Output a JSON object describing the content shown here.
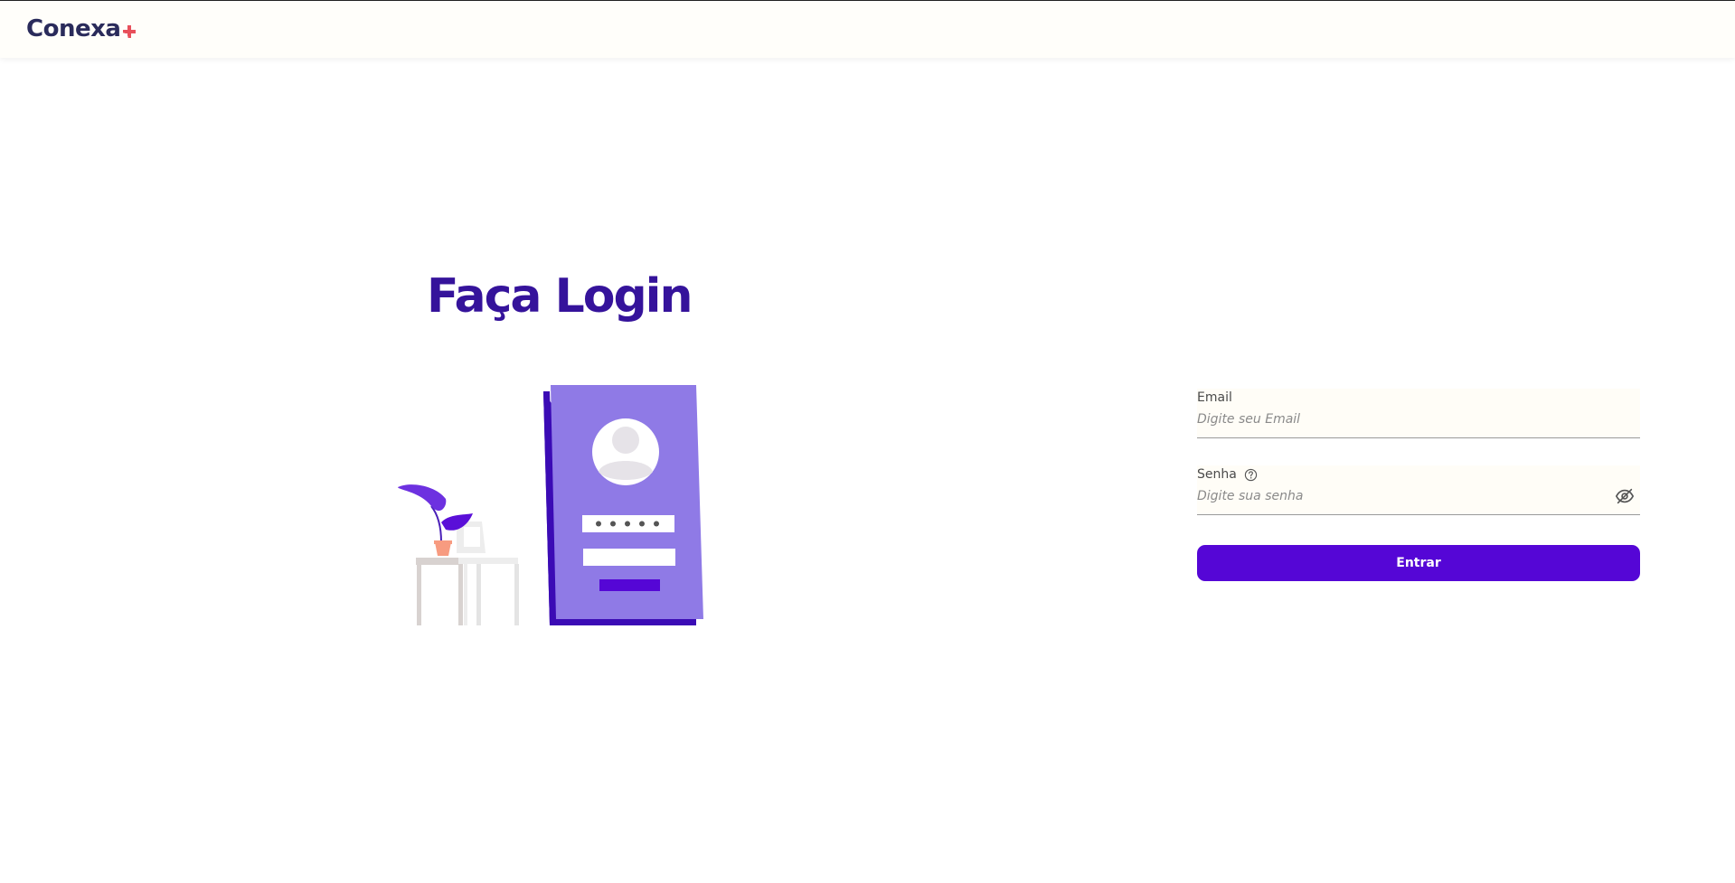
{
  "header": {
    "logo_text": "Conexa",
    "logo_icon": "plus-signal-icon"
  },
  "login": {
    "title": "Faça Login",
    "illustration": "login-phone-illustration"
  },
  "form": {
    "email": {
      "label": "Email",
      "placeholder": "Digite seu Email",
      "value": ""
    },
    "password": {
      "label": "Senha",
      "placeholder": "Digite sua senha",
      "value": "",
      "help_icon": "question-circle-icon",
      "toggle_icon": "eye-slash-icon"
    },
    "submit_label": "Entrar"
  },
  "colors": {
    "brand_dark": "#2a2b5b",
    "accent_red": "#e8505b",
    "primary": "#5506d6",
    "title": "#35139b",
    "illustration_purple": "#8f7ae6"
  }
}
